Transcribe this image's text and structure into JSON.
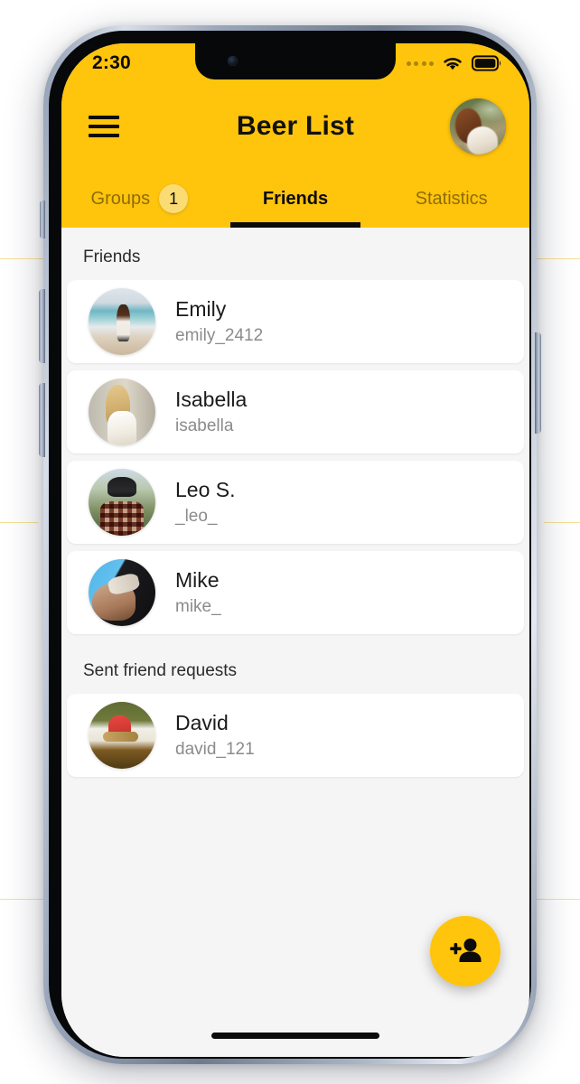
{
  "status_bar": {
    "time": "2:30",
    "signal_icon": "cellular-dots-icon",
    "wifi_icon": "wifi-icon",
    "battery_icon": "battery-full-icon"
  },
  "nav": {
    "menu_icon": "hamburger-menu-icon",
    "title": "Beer List",
    "avatar_icon": "profile-avatar"
  },
  "tabs": [
    {
      "label": "Groups",
      "badge": "1",
      "active": false
    },
    {
      "label": "Friends",
      "badge": null,
      "active": true
    },
    {
      "label": "Statistics",
      "badge": null,
      "active": false
    }
  ],
  "sections": [
    {
      "title": "Friends",
      "items": [
        {
          "name": "Emily",
          "handle": "emily_2412",
          "avatar": "avatar-emily"
        },
        {
          "name": "Isabella",
          "handle": "isabella",
          "avatar": "avatar-isabella"
        },
        {
          "name": "Leo S.",
          "handle": "_leo_",
          "avatar": "avatar-leo"
        },
        {
          "name": "Mike",
          "handle": "mike_",
          "avatar": "avatar-mike"
        }
      ]
    },
    {
      "title": "Sent friend requests",
      "items": [
        {
          "name": "David",
          "handle": "david_121",
          "avatar": "avatar-david"
        }
      ]
    }
  ],
  "fab": {
    "icon": "person-add-icon",
    "label": "Add friend"
  },
  "colors": {
    "brand_yellow": "#FFC40C",
    "badge_yellow": "#FBDC74",
    "list_background": "#F5F5F5",
    "card_background": "#FFFFFF",
    "primary_text": "#1B1B1B",
    "secondary_text": "#8B8B8B",
    "inactive_tab_text": "rgba(0,0,0,0.45)"
  }
}
